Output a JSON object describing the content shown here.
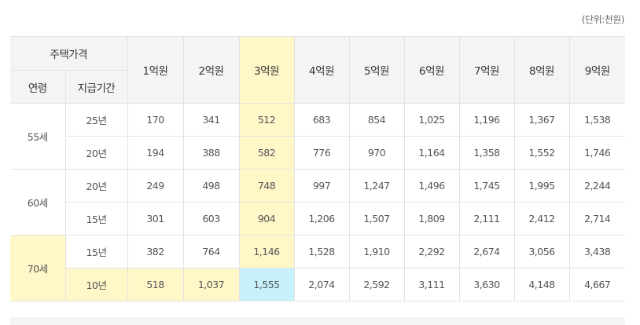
{
  "unit_note": "(단위:천원)",
  "header": {
    "house_price": "주택가격",
    "age": "연령",
    "period": "지급기간",
    "prices": [
      "1억원",
      "2억원",
      "3억원",
      "4억원",
      "5억원",
      "6억원",
      "7억원",
      "8억원",
      "9억원"
    ]
  },
  "groups": [
    {
      "age": "55세",
      "rows": [
        {
          "period": "25년",
          "values": [
            "170",
            "341",
            "512",
            "683",
            "854",
            "1,025",
            "1,196",
            "1,367",
            "1,538"
          ]
        },
        {
          "period": "20년",
          "values": [
            "194",
            "388",
            "582",
            "776",
            "970",
            "1,164",
            "1,358",
            "1,552",
            "1,746"
          ]
        }
      ]
    },
    {
      "age": "60세",
      "rows": [
        {
          "period": "20년",
          "values": [
            "249",
            "498",
            "748",
            "997",
            "1,247",
            "1,496",
            "1,745",
            "1,995",
            "2,244"
          ]
        },
        {
          "period": "15년",
          "values": [
            "301",
            "603",
            "904",
            "1,206",
            "1,507",
            "1,809",
            "2,111",
            "2,412",
            "2,714"
          ]
        }
      ]
    },
    {
      "age": "70세",
      "rows": [
        {
          "period": "15년",
          "values": [
            "382",
            "764",
            "1,146",
            "1,528",
            "1,910",
            "2,292",
            "2,674",
            "3,056",
            "3,438"
          ]
        },
        {
          "period": "10년",
          "values": [
            "518",
            "1,037",
            "1,555",
            "2,074",
            "2,592",
            "3,111",
            "3,630",
            "4,148",
            "4,667"
          ]
        }
      ]
    }
  ],
  "colors": {
    "highlight_yellow": "#fff7c8",
    "highlight_cyan": "#c7f1fb",
    "header_bg": "#f4f4f4"
  }
}
